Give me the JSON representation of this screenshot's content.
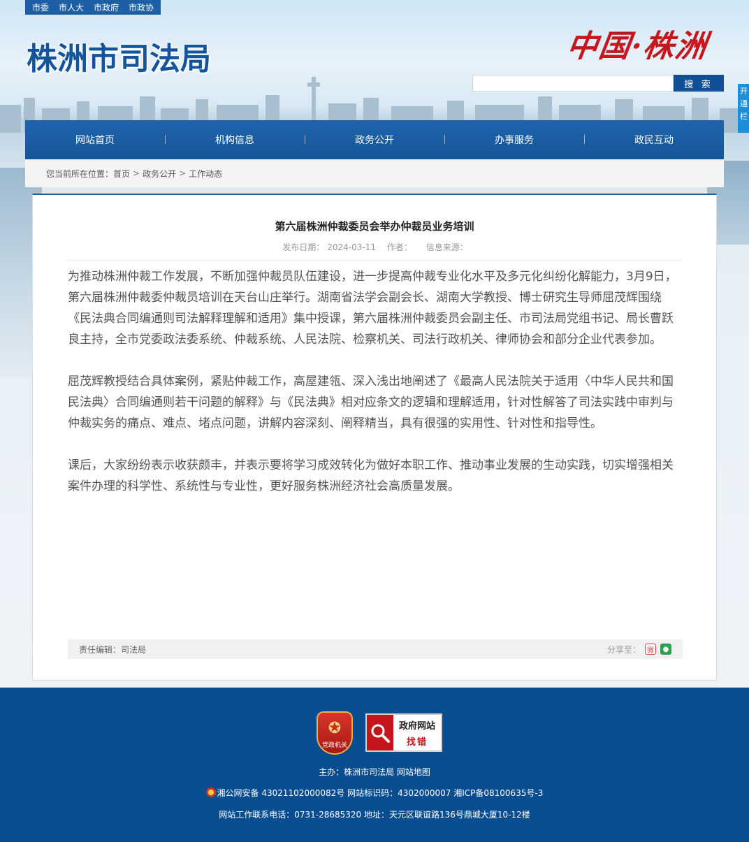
{
  "top_links": [
    "市委",
    "市人大",
    "市政府",
    "市政协"
  ],
  "site_title": "株洲市司法局",
  "calligraphy": "中国·株洲",
  "search": {
    "placeholder": "",
    "button_label": "搜 索"
  },
  "side_tab": "开通栏",
  "nav": [
    "网站首页",
    "机构信息",
    "政务公开",
    "办事服务",
    "政民互动"
  ],
  "breadcrumb": {
    "prefix": "您当前所在位置：",
    "items": [
      "首页",
      "政务公开",
      "工作动态"
    ]
  },
  "article": {
    "title": "第六届株洲仲裁委员会举办仲裁员业务培训",
    "date_label": "发布日期：",
    "date": "2024-03-11",
    "author_label": "作者：",
    "source_label": "信息来源：",
    "paragraphs": [
      "为推动株洲仲裁工作发展，不断加强仲裁员队伍建设，进一步提高仲裁专业化水平及多元化纠纷化解能力，3月9日，第六届株洲仲裁委仲裁员培训在天台山庄举行。湖南省法学会副会长、湖南大学教授、博士研究生导师屈茂辉围绕《民法典合同编通则司法解释理解和适用》集中授课，第六届株洲仲裁委员会副主任、市司法局党组书记、局长曹跃良主持，全市党委政法委系统、仲裁系统、人民法院、检察机关、司法行政机关、律师协会和部分企业代表参加。",
      "屈茂辉教授结合具体案例，紧贴仲裁工作，高屋建瓴、深入浅出地阐述了《最高人民法院关于适用〈中华人民共和国民法典〉合同编通则若干问题的解释》与《民法典》相对应条文的逻辑和理解适用，针对性解答了司法实践中审判与仲裁实务的痛点、难点、堵点问题，讲解内容深刻、阐释精当，具有很强的实用性、针对性和指导性。",
      "课后，大家纷纷表示收获颇丰，并表示要将学习成效转化为做好本职工作、推动事业发展的生动实践，切实增强相关案件办理的科学性、系统性与专业性，更好服务株洲经济社会高质量发展。"
    ],
    "editor": "责任编辑：司法局",
    "share_label": "分享至："
  },
  "footer": {
    "party_badge": "党政机关",
    "error_badge": {
      "line1": "政府网站",
      "line2": "找错"
    },
    "sponsor": "主办：株洲市司法局 网站地图",
    "record": "湘公网安备 43021102000082号 网站标识码：4302000007 湘ICP备08100635号-3",
    "contact": "网站工作联系电话：0731-28685320 地址：天元区联谊路136号鼎城大厦10-12楼"
  },
  "colors": {
    "brand_blue": "#1c5fa4",
    "footer_blue": "#094d91",
    "accent_red": "#c8161d"
  }
}
